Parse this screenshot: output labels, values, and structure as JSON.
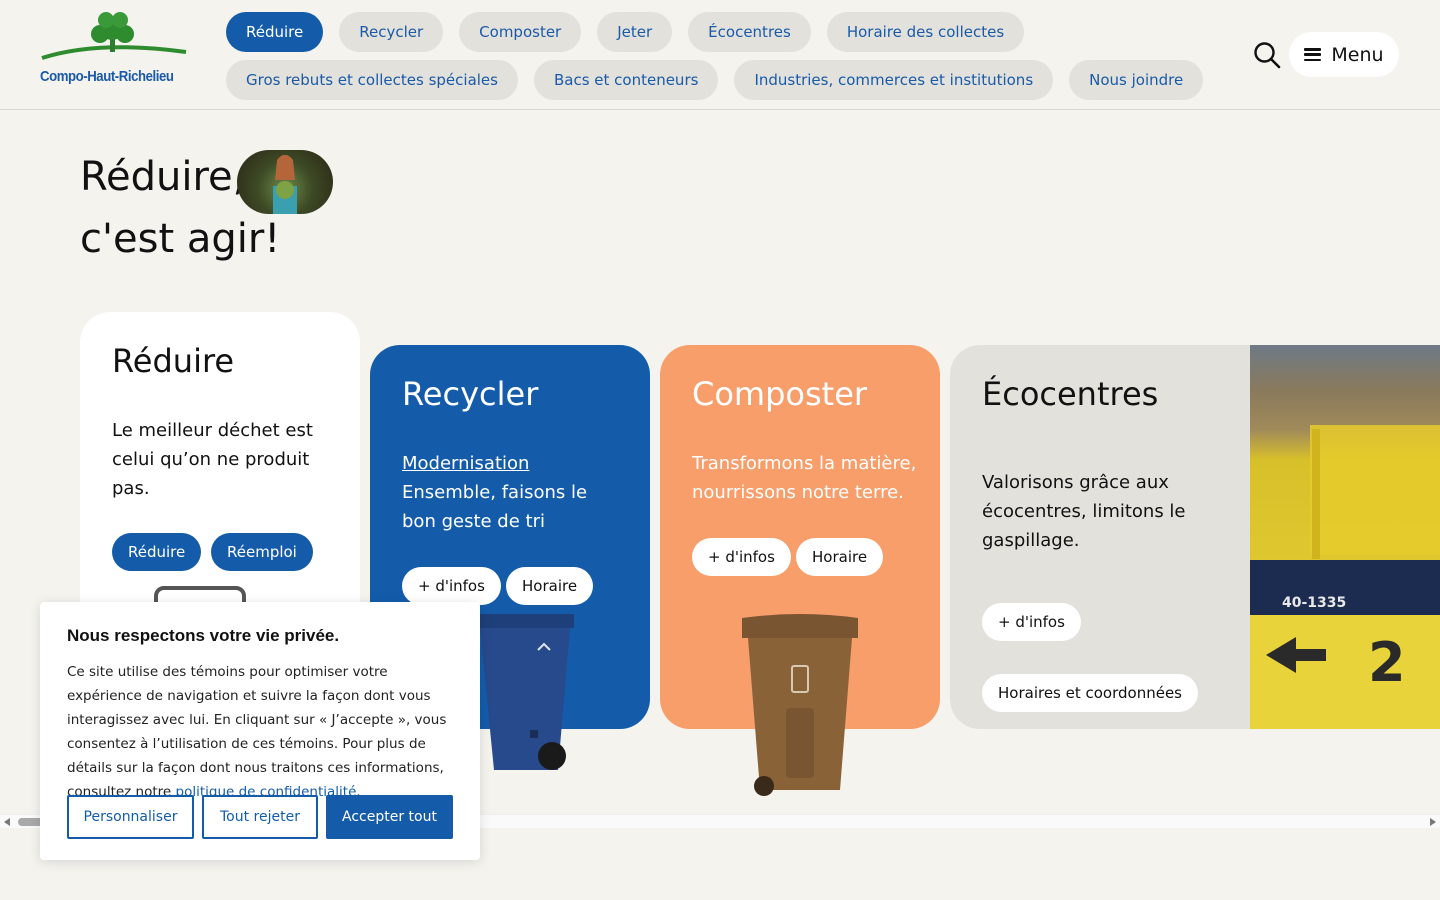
{
  "header": {
    "logo_text": "Compo-Haut-Richelieu",
    "nav_row1": [
      "Réduire",
      "Recycler",
      "Composter",
      "Jeter",
      "Écocentres",
      "Horaire des collectes"
    ],
    "nav_row2": [
      "Gros rebuts et collectes spéciales",
      "Bacs et conteneurs",
      "Industries, commerces et institutions",
      "Nous joindre"
    ],
    "menu_label": "Menu",
    "search_icon": "search-icon"
  },
  "hero": {
    "line1": "Réduire,",
    "line2": "c'est agir!"
  },
  "cards": {
    "reduire": {
      "title": "Réduire",
      "text": "Le meilleur déchet est celui qu’on ne produit pas.",
      "btn1": "Réduire",
      "btn2": "Réemploi"
    },
    "recycler": {
      "title": "Recycler",
      "link": "Modernisation",
      "text": "Ensemble, faisons le bon geste de tri",
      "btn1": "+ d'infos",
      "btn2": "Horaire"
    },
    "composter": {
      "title": "Composter",
      "text": "Transformons la matière, nourrissons notre terre.",
      "btn1": "+ d'infos",
      "btn2": "Horaire"
    },
    "ecocentres": {
      "title": "Écocentres",
      "text": "Valorisons grâce aux écocentres, limitons le gaspillage.",
      "btn1": "+ d'infos",
      "btn2": "Horaires et coordonnées",
      "photo_text1": "40-1335",
      "photo_text2": "2"
    }
  },
  "cookie": {
    "title": "Nous respectons votre vie privée.",
    "text_before": "Ce site utilise des témoins pour optimiser votre expérience de navigation et suivre la façon dont vous interagissez avec lui. En cliquant sur « J’accepte », vous consentez à l’utilisation de ces témoins. Pour plus de détails sur la façon dont nous traitons ces informations, consultez notre ",
    "link": "politique de confidentialité",
    "text_after": ".",
    "btn_customize": "Personnaliser",
    "btn_reject": "Tout rejeter",
    "btn_accept": "Accepter tout"
  },
  "colors": {
    "primary_blue": "#145caa",
    "orange": "#f79e6b",
    "beige": "#f4f3ee",
    "grey": "#e2e1db",
    "logo_green": "#2e8b2e"
  }
}
